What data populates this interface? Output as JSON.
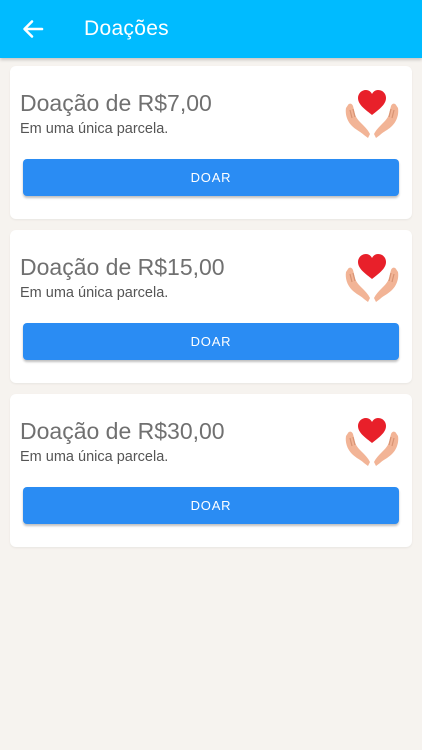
{
  "appbar": {
    "title": "Doações",
    "back_icon": "arrow-left-icon"
  },
  "colors": {
    "appbar": "#00bbff",
    "button": "#2a8cf3",
    "background": "#f6f3ef",
    "heart": "#e8202a",
    "hands": "#f2b496"
  },
  "donations": [
    {
      "title": "Doação de R$7,00",
      "subtitle": "Em uma única parcela.",
      "button_label": "DOAR",
      "icon": "heart-hands-icon"
    },
    {
      "title": "Doação de R$15,00",
      "subtitle": "Em uma única parcela.",
      "button_label": "DOAR",
      "icon": "heart-hands-icon"
    },
    {
      "title": "Doação de R$30,00",
      "subtitle": "Em uma única parcela.",
      "button_label": "DOAR",
      "icon": "heart-hands-icon"
    }
  ]
}
